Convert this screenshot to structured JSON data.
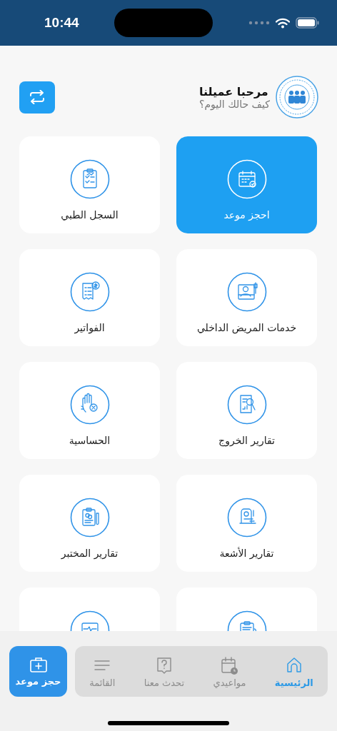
{
  "status_bar": {
    "time": "10:44"
  },
  "header": {
    "title": "مرحبا عميلنا",
    "subtitle": "كيف حالك اليوم؟"
  },
  "services": [
    {
      "label": "احجز موعد",
      "selected": true
    },
    {
      "label": "السجل الطبي",
      "selected": false
    },
    {
      "label": "خدمات المريض الداخلي",
      "selected": false
    },
    {
      "label": "الفواتير",
      "selected": false
    },
    {
      "label": "تقارير الخروج",
      "selected": false
    },
    {
      "label": "الحساسية",
      "selected": false
    },
    {
      "label": "تقارير الأشعة",
      "selected": false
    },
    {
      "label": "تقارير المختبر",
      "selected": false
    },
    {
      "selected": false
    },
    {
      "selected": false
    }
  ],
  "book_button": {
    "label": "حجز موعد"
  },
  "nav": [
    {
      "label": "الرئيسية",
      "selected": true
    },
    {
      "label": "مواعيدي",
      "selected": false
    },
    {
      "label": "تحدث معنا",
      "selected": false
    },
    {
      "label": "القائمة",
      "selected": false
    }
  ]
}
